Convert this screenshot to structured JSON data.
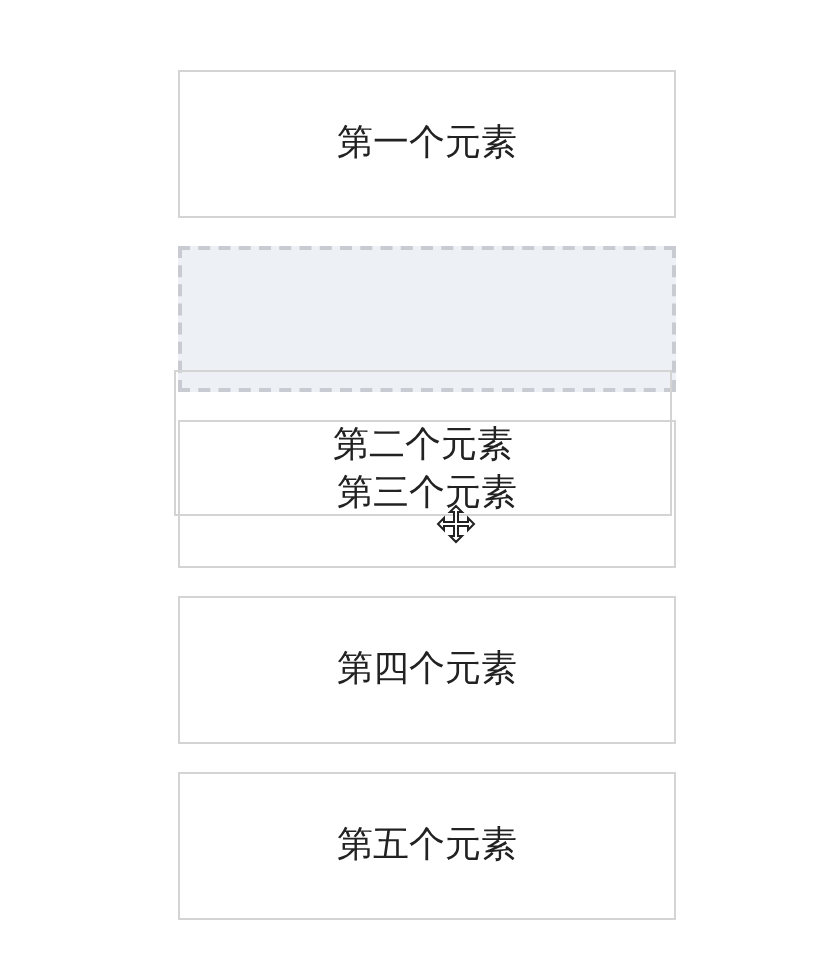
{
  "items": [
    {
      "kind": "item",
      "label": "第一个元素"
    },
    {
      "kind": "placeholder"
    },
    {
      "kind": "item",
      "label": "第三个元素"
    },
    {
      "kind": "item",
      "label": "第四个元素"
    },
    {
      "kind": "item",
      "label": "第五个元素"
    }
  ],
  "dragged": {
    "label": "第二个元素"
  }
}
